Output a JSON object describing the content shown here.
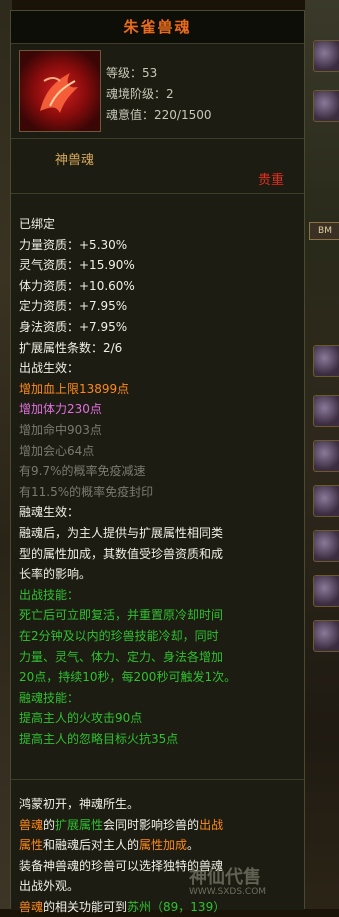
{
  "title": "朱雀兽魂",
  "icon": "phoenix-icon",
  "stats": {
    "level": "等级：53",
    "stage": "魂境阶级：2",
    "soul": "魂意值：220/1500"
  },
  "type_name": "神兽魂",
  "rarity": "贵重",
  "attributes": [
    {
      "text": "已绑定",
      "color": "w"
    },
    {
      "text": "力量资质：+5.30%",
      "color": "w"
    },
    {
      "text": "灵气资质：+15.90%",
      "color": "w"
    },
    {
      "text": "体力资质：+10.60%",
      "color": "w"
    },
    {
      "text": "定力资质：+7.95%",
      "color": "w"
    },
    {
      "text": "身法资质：+7.95%",
      "color": "w"
    },
    {
      "text": "扩展属性条数：2/6",
      "color": "w"
    },
    {
      "text": "出战生效：",
      "color": "w"
    },
    {
      "text": "增加血上限13899点",
      "color": "o"
    },
    {
      "text": "增加体力230点",
      "color": "p"
    },
    {
      "text": "增加命中903点",
      "color": "g"
    },
    {
      "text": "增加会心64点",
      "color": "g"
    },
    {
      "text": "有9.7%的概率免疫减速",
      "color": "g"
    },
    {
      "text": "有11.5%的概率免疫封印",
      "color": "g"
    },
    {
      "text": "融魂生效：",
      "color": "w"
    },
    {
      "text": "融魂后，为主人提供与扩展属性相同类",
      "color": "w"
    },
    {
      "text": "型的属性加成，其数值受珍兽资质和成",
      "color": "w"
    },
    {
      "text": "长率的影响。",
      "color": "w"
    },
    {
      "text": "出战技能：",
      "color": "gr"
    },
    {
      "text": "死亡后可立即复活，并重置原冷却时间",
      "color": "gr"
    },
    {
      "text": "在2分钟及以内的珍兽技能冷却，同时",
      "color": "gr"
    },
    {
      "text": "力量、灵气、体力、定力、身法各增加",
      "color": "gr"
    },
    {
      "text": "20点，持续10秒，每200秒可触发1次。",
      "color": "gr"
    },
    {
      "text": "融魂技能：",
      "color": "gr"
    },
    {
      "text": "提高主人的火攻击90点",
      "color": "gr"
    },
    {
      "text": "提高主人的忽略目标火抗35点",
      "color": "gr"
    }
  ],
  "description": [
    {
      "segments": [
        {
          "t": "鸿蒙初开，神魂所生。",
          "c": "w"
        }
      ]
    },
    {
      "segments": [
        {
          "t": "兽魂",
          "c": "o"
        },
        {
          "t": "的",
          "c": "w"
        },
        {
          "t": "扩展属性",
          "c": "gr"
        },
        {
          "t": "会同时影响珍兽的",
          "c": "w"
        },
        {
          "t": "出战",
          "c": "o"
        }
      ]
    },
    {
      "segments": [
        {
          "t": "属性",
          "c": "o"
        },
        {
          "t": "和融魂后对主人的",
          "c": "w"
        },
        {
          "t": "属性加成",
          "c": "o"
        },
        {
          "t": "。",
          "c": "w"
        }
      ]
    },
    {
      "segments": [
        {
          "t": "装备神兽魂的珍兽可以选择独特的兽魂",
          "c": "w"
        }
      ]
    },
    {
      "segments": [
        {
          "t": "出战外观。",
          "c": "w"
        }
      ]
    },
    {
      "segments": [
        {
          "t": "兽魂",
          "c": "o"
        },
        {
          "t": "的相关功能可到",
          "c": "w"
        },
        {
          "t": "苏州（89，139）",
          "c": "gr"
        }
      ]
    }
  ],
  "watermark": {
    "main": "神仙代售",
    "sub": "WWW.SXDS.COM"
  },
  "side_buttons": [
    "BM"
  ]
}
